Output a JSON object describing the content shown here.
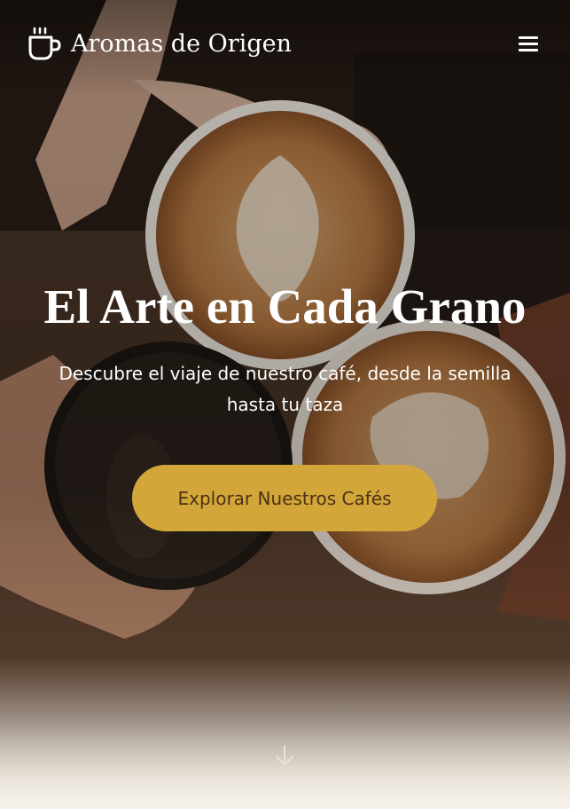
{
  "header": {
    "brand": "Aromas de Origen",
    "logo_icon": "coffee-cup-icon",
    "menu_icon": "hamburger-menu-icon"
  },
  "hero": {
    "title": "El Arte en Cada Grano",
    "subtitle": "Descubre el viaje de nuestro café, desde la semilla hasta tu taza",
    "cta_label": "Explorar Nuestros Cafés",
    "scroll_icon": "arrow-down-icon",
    "background_image": "hands toasting with latte art coffee cups"
  },
  "colors": {
    "accent": "#d3a639",
    "cta_text": "#4a3215",
    "text_light": "#ffffff",
    "page_bottom": "#f6f1e8"
  }
}
